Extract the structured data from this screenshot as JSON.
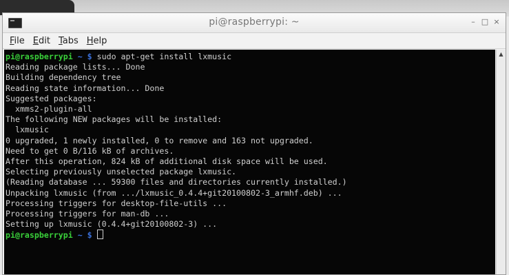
{
  "window": {
    "title": "pi@raspberrypi: ~",
    "buttons": {
      "minimize": "–",
      "maximize": "□",
      "close": "×"
    }
  },
  "menubar": {
    "items": [
      {
        "mnemonic": "F",
        "rest": "ile"
      },
      {
        "mnemonic": "E",
        "rest": "dit"
      },
      {
        "mnemonic": "T",
        "rest": "abs"
      },
      {
        "mnemonic": "H",
        "rest": "elp"
      }
    ]
  },
  "terminal": {
    "prompt_user": "pi@raspberrypi",
    "prompt_path": " ~ $",
    "command": " sudo apt-get install lxmusic",
    "output": [
      "Reading package lists... Done",
      "Building dependency tree",
      "Reading state information... Done",
      "Suggested packages:",
      "  xmms2-plugin-all",
      "The following NEW packages will be installed:",
      "  lxmusic",
      "0 upgraded, 1 newly installed, 0 to remove and 163 not upgraded.",
      "Need to get 0 B/116 kB of archives.",
      "After this operation, 824 kB of additional disk space will be used.",
      "Selecting previously unselected package lxmusic.",
      "(Reading database ... 59300 files and directories currently installed.)",
      "Unpacking lxmusic (from .../lxmusic_0.4.4+git20100802-3_armhf.deb) ...",
      "Processing triggers for desktop-file-utils ...",
      "Processing triggers for man-db ...",
      "Setting up lxmusic (0.4.4+git20100802-3) ..."
    ],
    "final_prompt_user": "pi@raspberrypi",
    "final_prompt_path": " ~ $ "
  },
  "scrollbar": {
    "up_arrow": "▲"
  },
  "colors": {
    "terminal_bg": "#060606",
    "terminal_fg": "#d0d0d0",
    "prompt_user": "#3ad13a",
    "prompt_path": "#3a6fd8"
  }
}
